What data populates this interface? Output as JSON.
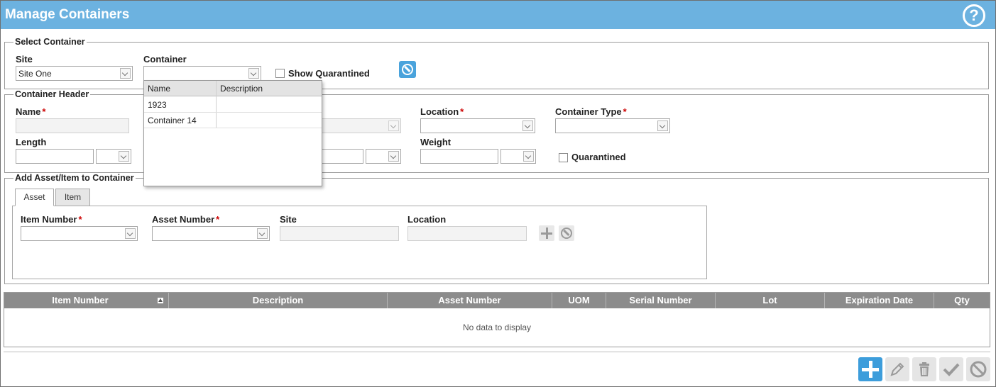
{
  "header": {
    "title": "Manage Containers",
    "help_icon": "help-icon",
    "help_glyph": "?"
  },
  "select_container": {
    "legend": "Select Container",
    "site_label": "Site",
    "site_value": "Site One",
    "container_label": "Container",
    "container_value": "",
    "show_quarantined_label": "Show Quarantined"
  },
  "container_dropdown": {
    "columns": [
      "Name",
      "Description"
    ],
    "rows": [
      {
        "name": "1923",
        "description": ""
      },
      {
        "name": "Container 14",
        "description": ""
      }
    ]
  },
  "container_header": {
    "legend": "Container Header",
    "name_label": "Name",
    "location_label": "Location",
    "container_type_label": "Container Type",
    "length_label": "Length",
    "weight_label": "Weight",
    "quarantined_label": "Quarantined",
    "required_mark": "*"
  },
  "add_asset": {
    "legend": "Add Asset/Item to Container",
    "tabs": [
      "Asset",
      "Item"
    ],
    "active_tab": "Asset",
    "item_number_label": "Item Number",
    "asset_number_label": "Asset Number",
    "site_label": "Site",
    "location_label": "Location"
  },
  "grid": {
    "columns": [
      "Item Number",
      "Description",
      "Asset Number",
      "UOM",
      "Serial Number",
      "Lot",
      "Expiration Date",
      "Qty"
    ],
    "empty_text": "No data to display"
  },
  "colors": {
    "title_bar": "#6cb2e0",
    "accent": "#3d9ddb",
    "grid_header": "#8c8c8c",
    "required": "#cc0000"
  }
}
